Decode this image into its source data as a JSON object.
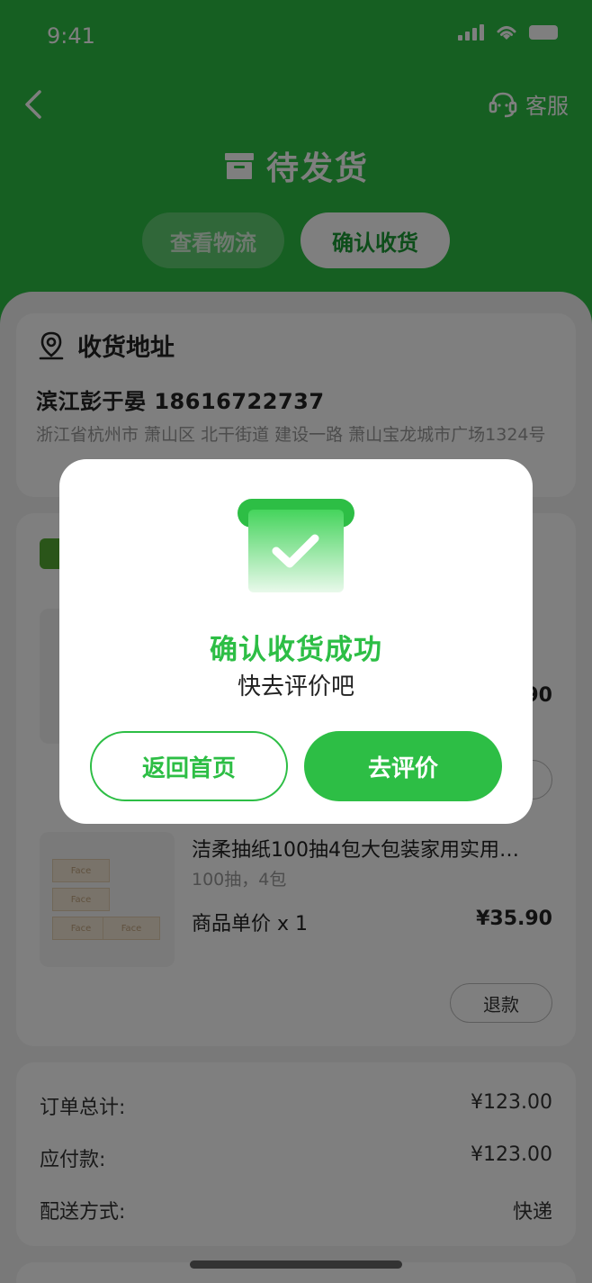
{
  "status_bar": {
    "time": "9:41"
  },
  "nav": {
    "back_icon": "chevron-left-icon",
    "service_icon": "headset-icon",
    "service_label": "客服"
  },
  "page": {
    "title_icon": "box-icon",
    "title": "待发货"
  },
  "actions": {
    "logistics_label": "查看物流",
    "confirm_label": "确认收货"
  },
  "address": {
    "section_title": "收货地址",
    "icon": "location-icon",
    "name_phone": "滨江彭于晏  18616722737",
    "detail": "浙江省杭州市 萧山区 北干街道 建设一路 萧山宝龙城市广场1324号"
  },
  "goods": {
    "item1": {
      "price_tail": "90"
    },
    "item2": {
      "name": "洁柔抽纸100抽4包大包装家用实用…",
      "spec": "100抽，4包",
      "unit_label": "商品单价  x 1",
      "price": "¥35.90",
      "refund_label": "退款",
      "image_brand": "Face"
    }
  },
  "summary": {
    "rows": [
      {
        "label": "订单总计:",
        "value": "¥123.00"
      },
      {
        "label": "应付款:",
        "value": "¥123.00"
      },
      {
        "label": "配送方式:",
        "value": "快递"
      }
    ]
  },
  "modal": {
    "icon": "check-box-icon",
    "title": "确认收货成功",
    "subtitle": "快去评价吧",
    "home_label": "返回首页",
    "review_label": "去评价"
  },
  "colors": {
    "brand": "#2dbe45",
    "brand_dark": "#1b9a35"
  }
}
